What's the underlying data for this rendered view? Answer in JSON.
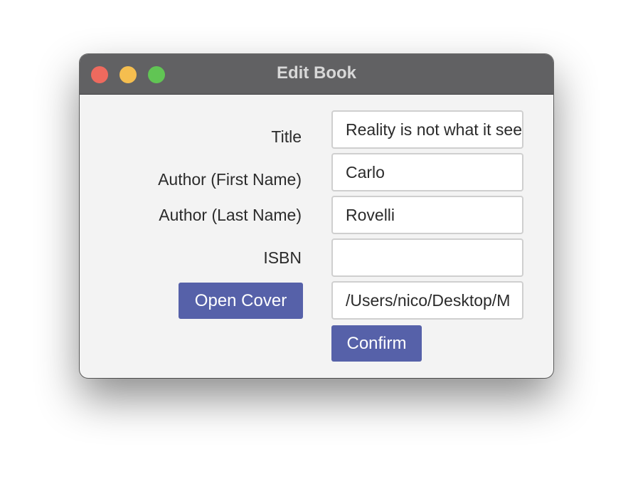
{
  "window": {
    "title": "Edit Book"
  },
  "form": {
    "title_label": "Title",
    "title_value": "Reality is not what it seems",
    "author_first_label": "Author (First Name)",
    "author_first_value": "Carlo",
    "author_last_label": "Author (Last Name)",
    "author_last_value": "Rovelli",
    "isbn_label": "ISBN",
    "isbn_value": "",
    "cover_path_value": "/Users/nico/Desktop/M"
  },
  "buttons": {
    "open_cover": "Open Cover",
    "confirm": "Confirm"
  },
  "colors": {
    "titlebar": "#616163",
    "close": "#ee6a5e",
    "minimize": "#f5be4f",
    "zoom": "#61c554",
    "button": "#5661a9",
    "window_background": "#f3f3f3"
  }
}
